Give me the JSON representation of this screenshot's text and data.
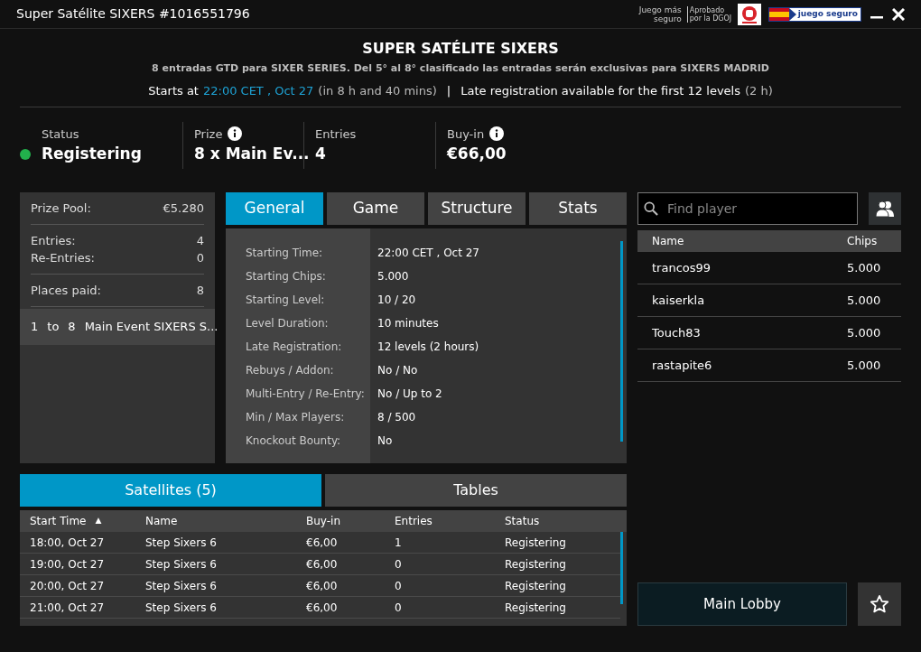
{
  "window": {
    "title": "Super Satélite SIXERS #1016551796",
    "badges": [
      "Juego más seguro",
      "Aprobado por la DGOJ"
    ],
    "logo_text": "juego seguro"
  },
  "header": {
    "title": "SUPER SATÉLITE SIXERS",
    "subtitle": "8 entradas GTD para SIXER SERIES. Del 5° al 8° clasificado las entradas serán exclusivas para SIXERS MADRID",
    "starts_label": "Starts at",
    "starts_time": "22:00 CET , Oct 27",
    "starts_in": "(in 8 h and 40 mins)",
    "separator": "|",
    "late_reg": "Late registration available for the first 12 levels",
    "late_reg_time": "(2 h)"
  },
  "summary": [
    {
      "label": "Status",
      "value": "Registering",
      "color": "#22b14c",
      "info": false
    },
    {
      "label": "Prize",
      "value": "8 x Main Ev...",
      "info": true
    },
    {
      "label": "Entries",
      "value": "4",
      "info": false
    },
    {
      "label": "Buy-in",
      "value": "€66,00",
      "info": true
    }
  ],
  "prize_panel": {
    "groups": [
      [
        {
          "label": "Prize Pool:",
          "value": "€5.280"
        }
      ],
      [
        {
          "label": "Entries:",
          "value": "4"
        },
        {
          "label": "Re-Entries:",
          "value": "0"
        }
      ],
      [
        {
          "label": "Places paid:",
          "value": "8"
        }
      ]
    ],
    "payouts": [
      {
        "from": "1",
        "to_word": "to",
        "to": "8",
        "prize": "Main Event SIXERS S...",
        "selected": true
      }
    ]
  },
  "tabs": [
    {
      "label": "General",
      "selected": true
    },
    {
      "label": "Game",
      "selected": false
    },
    {
      "label": "Structure",
      "selected": false
    },
    {
      "label": "Stats",
      "selected": false
    }
  ],
  "general": [
    {
      "label": "Starting Time:",
      "value": "22:00 CET , Oct 27"
    },
    {
      "label": "Starting Chips:",
      "value": "5.000"
    },
    {
      "label": "Starting Level:",
      "value": "10 / 20"
    },
    {
      "label": "Level Duration:",
      "value": "10 minutes"
    },
    {
      "label": "Late Registration:",
      "value": "12 levels (2 hours)"
    },
    {
      "label": "Rebuys / Addon:",
      "value": "No / No"
    },
    {
      "label": "Multi-Entry / Re-Entry:",
      "value": "No / Up to 2"
    },
    {
      "label": "Min / Max Players:",
      "value": "8 / 500"
    },
    {
      "label": "Knockout Bounty:",
      "value": "No"
    }
  ],
  "bottom_tabs": [
    {
      "label": "Satellites (5)",
      "selected": true
    },
    {
      "label": "Tables",
      "selected": false
    }
  ],
  "satellites": {
    "columns": [
      {
        "label": "Start Time",
        "sorted": true
      },
      {
        "label": "Name",
        "sorted": false
      },
      {
        "label": "Buy-in",
        "sorted": false
      },
      {
        "label": "Entries",
        "sorted": false
      },
      {
        "label": "Status",
        "sorted": false
      }
    ],
    "sort_arrow": "▲",
    "rows": [
      [
        "18:00, Oct 27",
        "Step Sixers 6",
        "€6,00",
        "1",
        "Registering"
      ],
      [
        "19:00, Oct 27",
        "Step Sixers 6",
        "€6,00",
        "0",
        "Registering"
      ],
      [
        "20:00, Oct 27",
        "Step Sixers 6",
        "€6,00",
        "0",
        "Registering"
      ],
      [
        "21:00, Oct 27",
        "Step Sixers 6",
        "€6,00",
        "0",
        "Registering"
      ]
    ]
  },
  "players": {
    "search": {
      "placeholder": "Find player"
    },
    "columns": [
      "Name",
      "Chips"
    ],
    "rows": [
      [
        "trancos99",
        "5.000"
      ],
      [
        "kaiserkla",
        "5.000"
      ],
      [
        "Touch83",
        "5.000"
      ],
      [
        "rastapite6",
        "5.000"
      ]
    ]
  },
  "footer": {
    "main_lobby": "Main Lobby"
  }
}
